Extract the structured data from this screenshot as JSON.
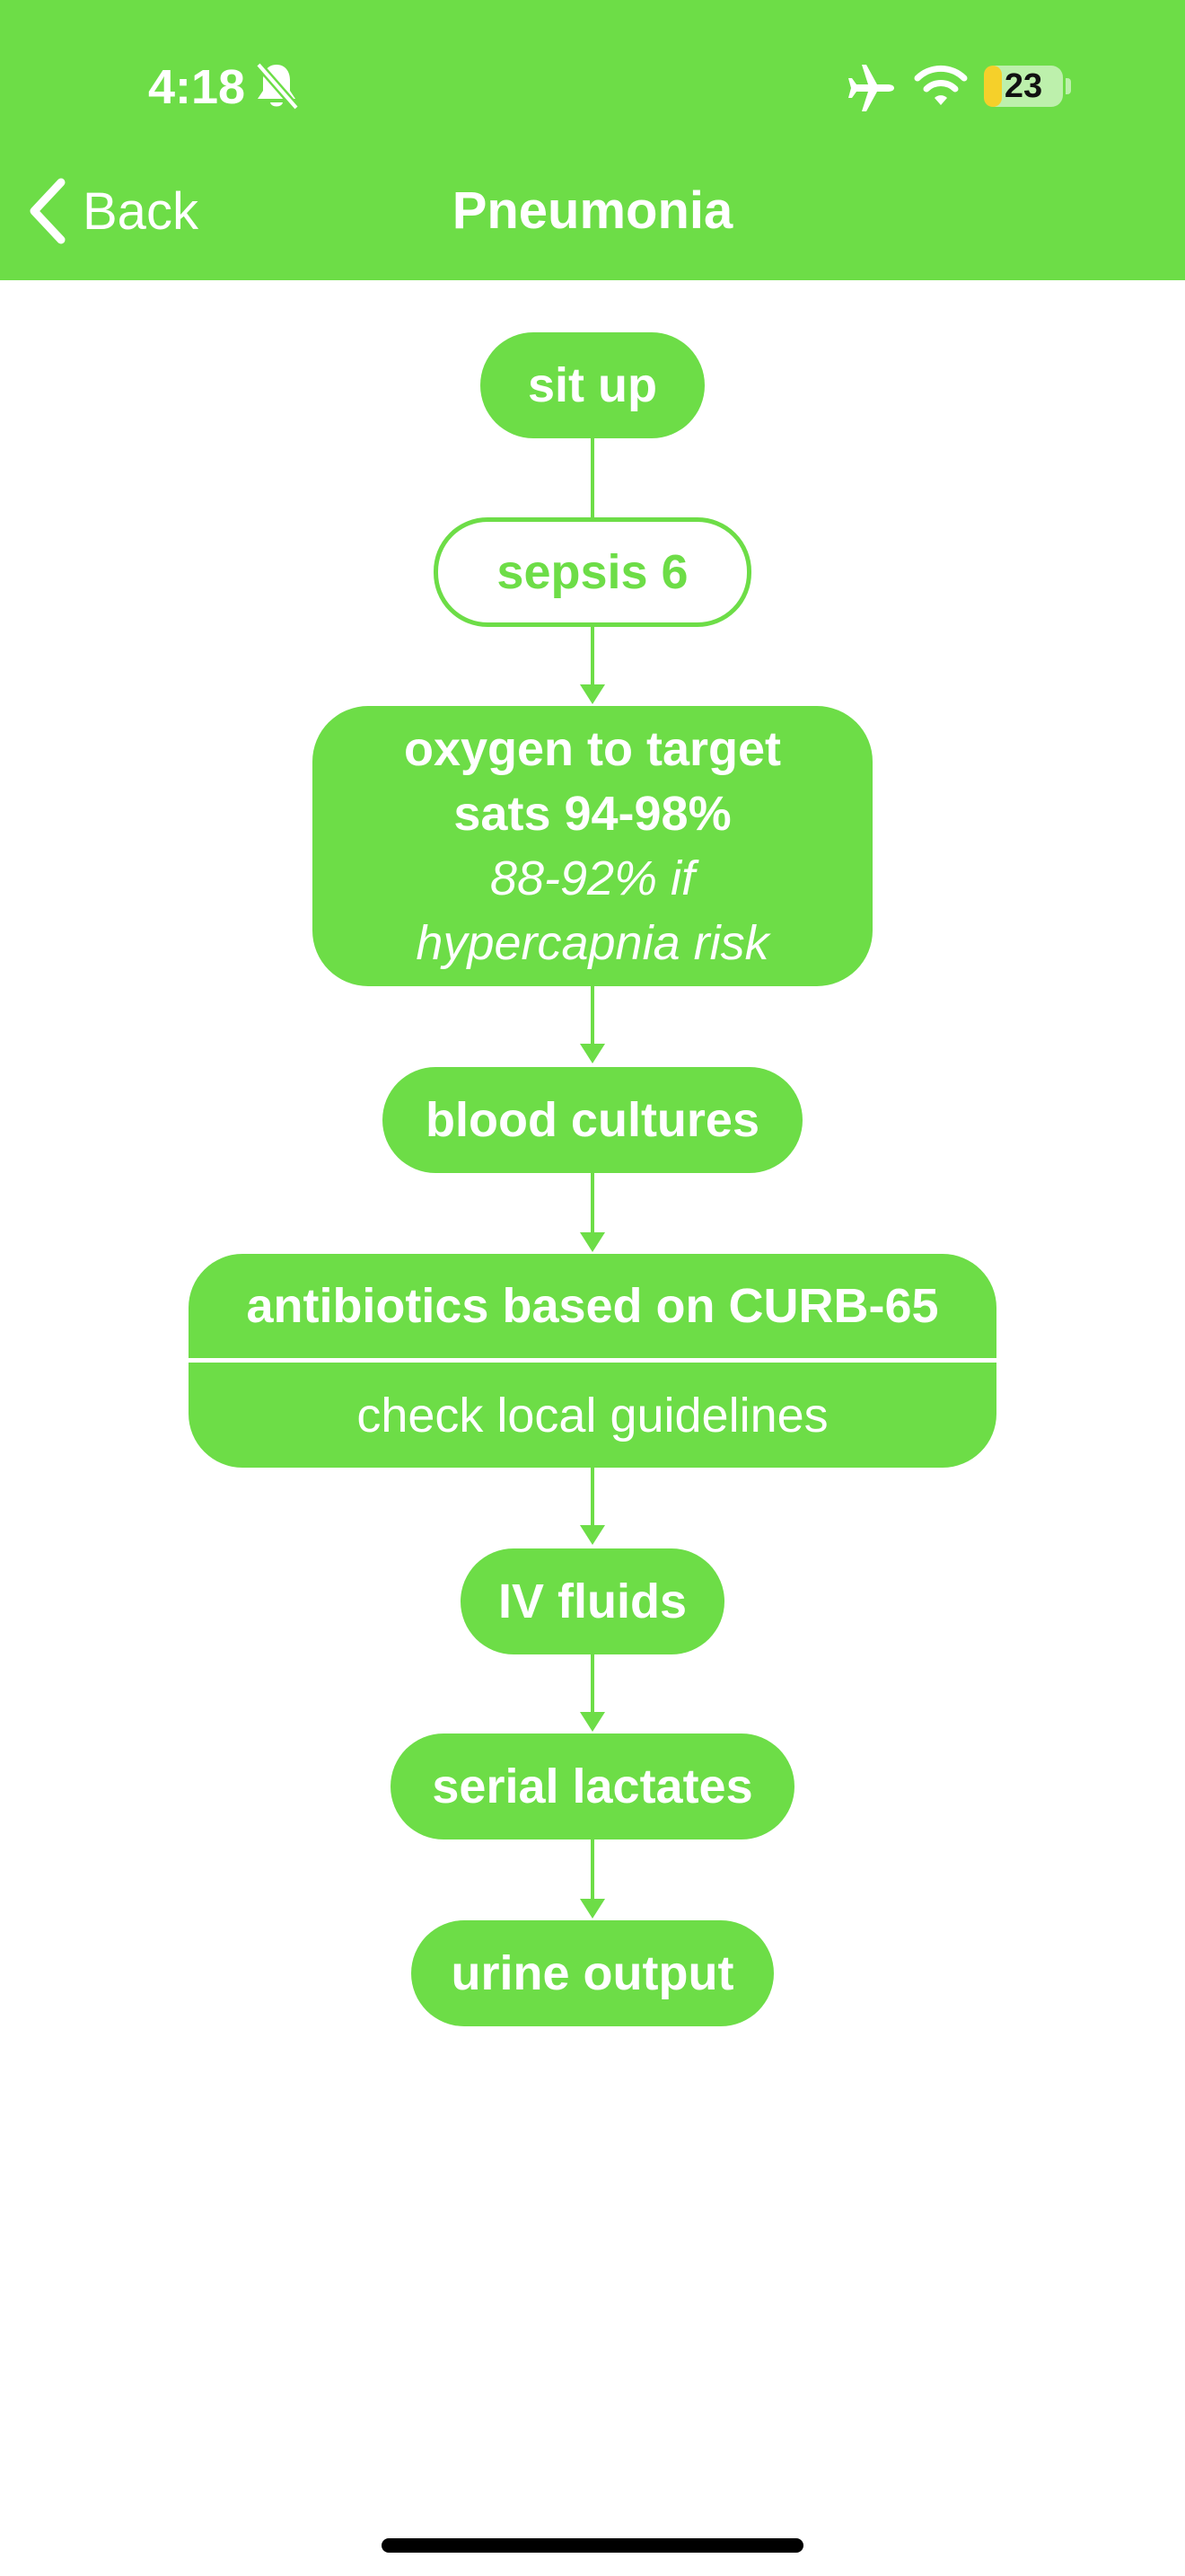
{
  "status_bar": {
    "time": "4:18",
    "battery": "23",
    "battery_level": 0.23,
    "icons": [
      "bell-slash-icon",
      "airplane-icon",
      "wifi-icon",
      "battery-icon"
    ]
  },
  "nav": {
    "back_label": "Back",
    "title": "Pneumonia"
  },
  "colors": {
    "accent": "#6ddd47",
    "background": "#ffffff"
  },
  "flow": {
    "step1": "sit up",
    "step2": "sepsis 6",
    "step3_line1": "oxygen to target",
    "step3_line2": "sats 94-98%",
    "step3_line3": "88-92% if",
    "step3_line4": "hypercapnia risk",
    "step4": "blood cultures",
    "step5_title": "antibiotics based on CURB-65",
    "step5_note": "check local guidelines",
    "step6": "IV fluids",
    "step7": "serial lactates",
    "step8": "urine output"
  }
}
